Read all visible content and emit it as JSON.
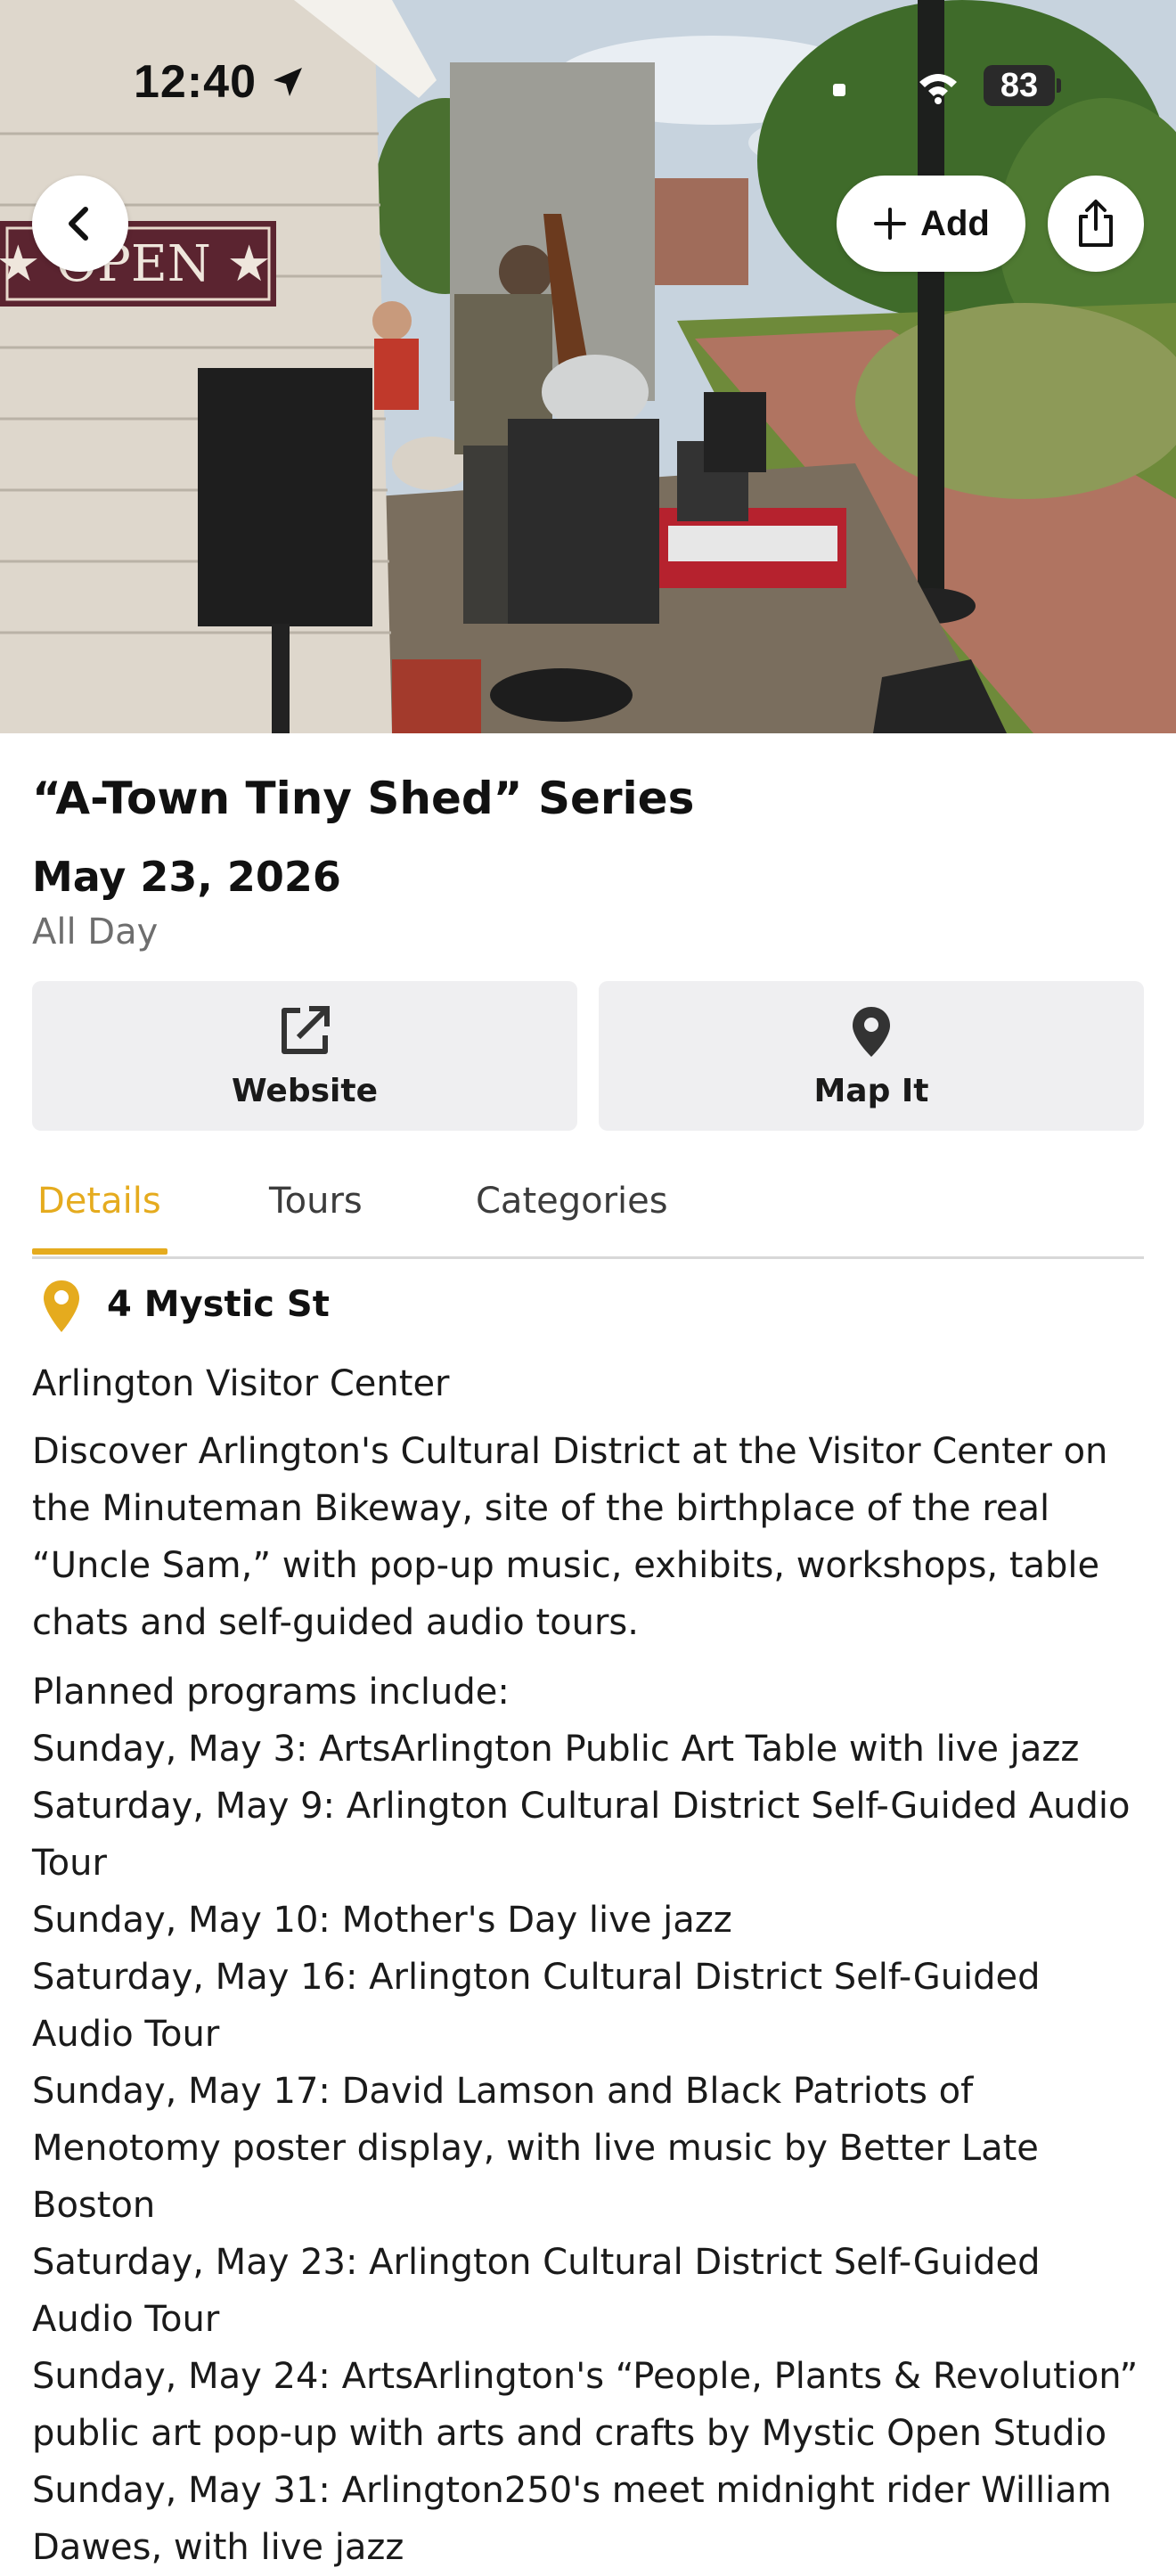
{
  "status_bar": {
    "time": "12:40",
    "battery": "83"
  },
  "hero": {
    "add_label": "Add",
    "sign_text": "★ OPEN ★"
  },
  "event": {
    "title": "“A-Town Tiny Shed” Series",
    "date": "May 23, 2026",
    "time": "All Day"
  },
  "actions": {
    "website_label": "Website",
    "mapit_label": "Map It"
  },
  "tabs": [
    {
      "label": "Details",
      "active": true
    },
    {
      "label": "Tours",
      "active": false
    },
    {
      "label": "Categories",
      "active": false
    }
  ],
  "details": {
    "address": "4 Mystic St",
    "venue": "Arlington Visitor Center",
    "description": "Discover Arlington's Cultural District at the Visitor Center on the Minuteman Bikeway, site of the birthplace of the real “Uncle Sam,” with pop-up music, exhibits, workshops, table chats and self-guided audio tours.",
    "programs_intro": "Planned programs include:",
    "programs": [
      "Sunday, May 3: ArtsArlington Public Art Table with live jazz",
      "Saturday, May 9: Arlington Cultural District Self-Guided Audio Tour",
      "Sunday, May 10: Mother's Day live jazz",
      "Saturday, May 16: Arlington Cultural District Self-Guided Audio Tour",
      "Sunday, May 17: David Lamson and Black Patriots of Menotomy poster display, with live music by Better Late Boston",
      "Saturday, May 23: Arlington Cultural District Self-Guided Audio Tour",
      "Sunday, May 24: ArtsArlington's “People, Plants & Revolution” public art pop-up with arts and crafts by Mystic Open Studio",
      "Sunday, May 31: Arlington250's meet midnight rider William Dawes, with live jazz"
    ]
  },
  "colors": {
    "accent": "#e5ab1e",
    "button_bg": "#efeff1",
    "muted_text": "#6e6e6e"
  },
  "icons": {
    "back": "chevron-left-icon",
    "add": "plus-icon",
    "share": "share-icon",
    "website": "external-link-icon",
    "map": "map-pin-icon",
    "address": "location-pin-icon"
  }
}
